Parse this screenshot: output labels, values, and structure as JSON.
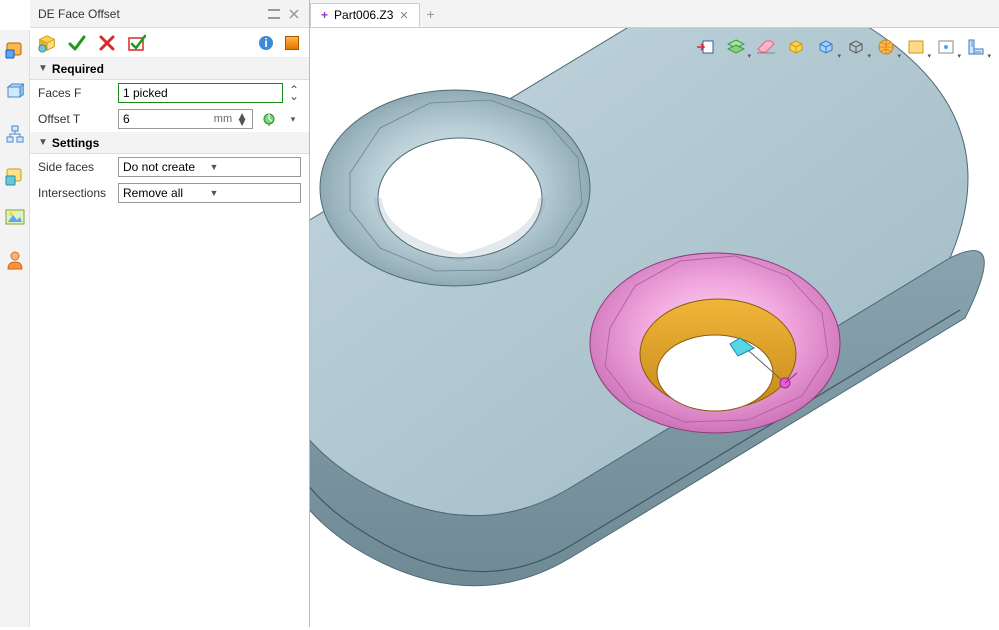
{
  "panel": {
    "title": "DE Face Offset",
    "sections": {
      "required": {
        "label": "Required",
        "faces": {
          "label": "Faces F",
          "value": "1 picked"
        },
        "offset": {
          "label": "Offset T",
          "value": "6",
          "unit": "mm"
        }
      },
      "settings": {
        "label": "Settings",
        "side_faces": {
          "label": "Side faces",
          "value": "Do not create"
        },
        "intersections": {
          "label": "Intersections",
          "value": "Remove all"
        }
      }
    }
  },
  "tabs": {
    "active": {
      "label": "Part006.Z3"
    }
  }
}
